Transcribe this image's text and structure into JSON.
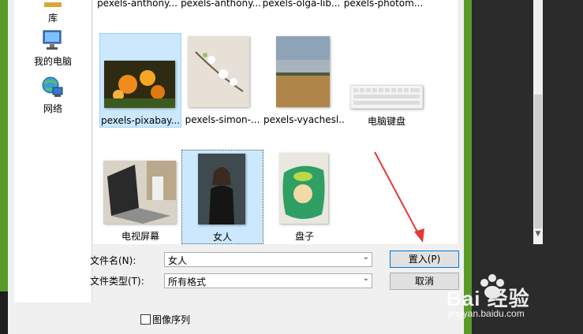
{
  "nav": {
    "items": [
      {
        "label": "库",
        "icon": "library-icon"
      },
      {
        "label": "我的电脑",
        "icon": "computer-icon"
      },
      {
        "label": "网络",
        "icon": "network-icon"
      }
    ]
  },
  "files": {
    "top_row": [
      "pexels-anthony...",
      "pexels-anthony...",
      "pexels-olga-lib...",
      "pexels-photom..."
    ],
    "row2": [
      "pexels-pixabay...",
      "pexels-simon-...",
      "pexels-vyachesl...",
      "电脑键盘"
    ],
    "row3": [
      "电视屏幕",
      "女人",
      "盘子"
    ],
    "selected": "女人"
  },
  "form": {
    "filename_label": "文件名(N):",
    "filename_value": "女人",
    "filetype_label": "文件类型(T):",
    "filetype_value": "所有格式",
    "place_button": "置入(P)",
    "cancel_button": "取消",
    "sequence_label": "图像序列"
  },
  "watermark": {
    "brand": "Bai 经验",
    "url": "jingyan.baidu.com"
  },
  "colors": {
    "window_frame": "#5a9a2b",
    "selection": "#cce8ff",
    "annotation_arrow": "#e53935"
  }
}
